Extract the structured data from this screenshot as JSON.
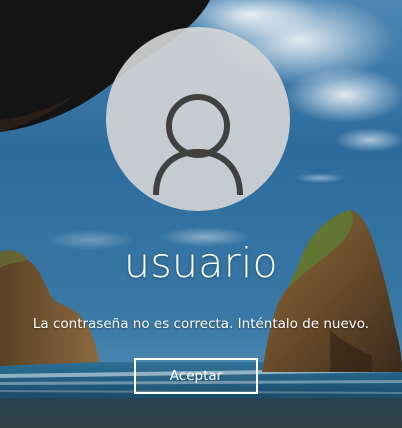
{
  "user": {
    "name": "usuario",
    "avatar_icon": "user-silhouette-icon"
  },
  "message": {
    "text": "La contraseña no es correcta. Inténtalo de nuevo."
  },
  "actions": {
    "accept_label": "Aceptar"
  },
  "colors": {
    "sky_top": "#3f7aa8",
    "sky_mid": "#1f5f94",
    "sea": "#1d5a7f",
    "avatar_bg": "#d6d6d6",
    "avatar_icon": "#404040",
    "text": "#ffffff"
  }
}
